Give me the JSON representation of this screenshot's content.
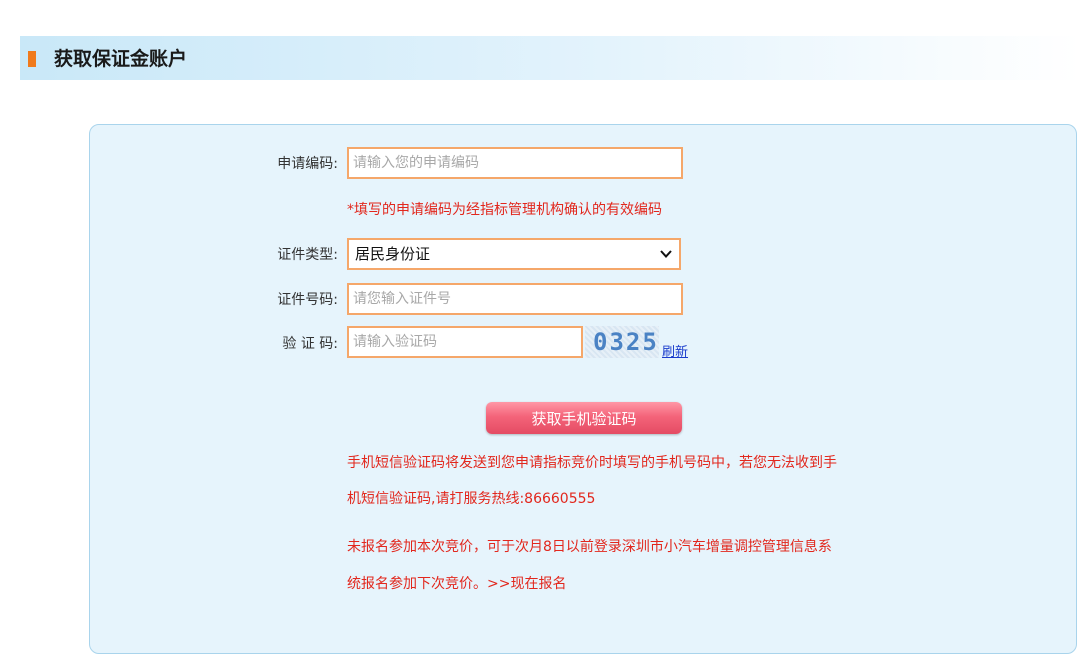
{
  "header": {
    "title": "获取保证金账户"
  },
  "form": {
    "application_code": {
      "label": "申请编码:",
      "placeholder": "请输入您的申请编码",
      "hint": "*填写的申请编码为经指标管理机构确认的有效编码"
    },
    "id_type": {
      "label": "证件类型:",
      "selected": "居民身份证"
    },
    "id_number": {
      "label": "证件号码:",
      "placeholder": "请您输入证件号"
    },
    "captcha": {
      "label": "验 证 码:",
      "placeholder": "请输入验证码",
      "image_text": "0325",
      "refresh_label": "刷新"
    },
    "sms_button_label": "获取手机验证码"
  },
  "notices": {
    "sms_line1": "手机短信验证码将发送到您申请指标竞价时填写的手机号码中，若您无法收到手",
    "sms_line2": "机短信验证码,请打服务热线:86660555",
    "register_line1": "未报名参加本次竞价，可于次月8日以前登录深圳市小汽车增量调控管理信息系",
    "register_line2": "统报名参加下次竞价。>>现在报名"
  },
  "colors": {
    "accent_orange": "#f07a1c",
    "input_border": "#f5a76a",
    "warning_red": "#e2271d",
    "button_pink": "#f4647a",
    "panel_bg": "#e6f4fc"
  },
  "icons": {
    "section_marker": "section-marker-icon",
    "dropdown": "chevron-down-icon"
  }
}
